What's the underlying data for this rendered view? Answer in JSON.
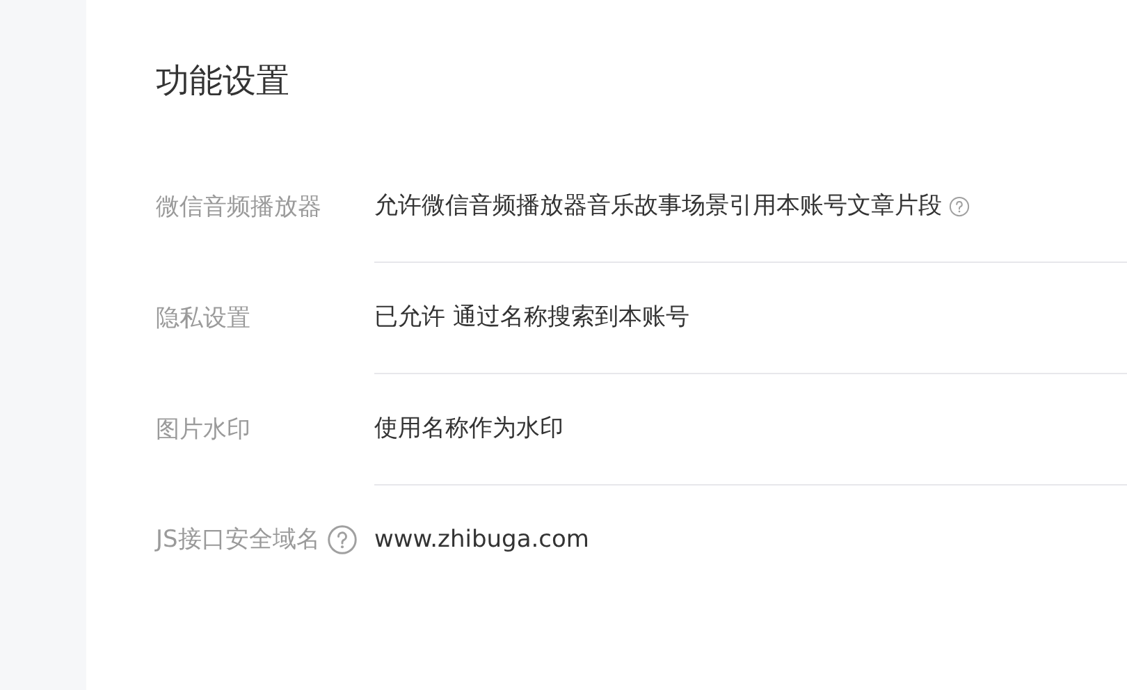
{
  "title": "功能设置",
  "settings": [
    {
      "label": "微信音频播放器",
      "label_help": false,
      "value": "允许微信音频播放器音乐故事场景引用本账号文章片段",
      "value_help": true
    },
    {
      "label": "隐私设置",
      "label_help": false,
      "value": "已允许 通过名称搜索到本账号",
      "value_help": false
    },
    {
      "label": "图片水印",
      "label_help": false,
      "value": "使用名称作为水印",
      "value_help": false
    },
    {
      "label": "JS接口安全域名",
      "label_help": true,
      "value": "www.zhibuga.com",
      "value_help": false
    }
  ]
}
